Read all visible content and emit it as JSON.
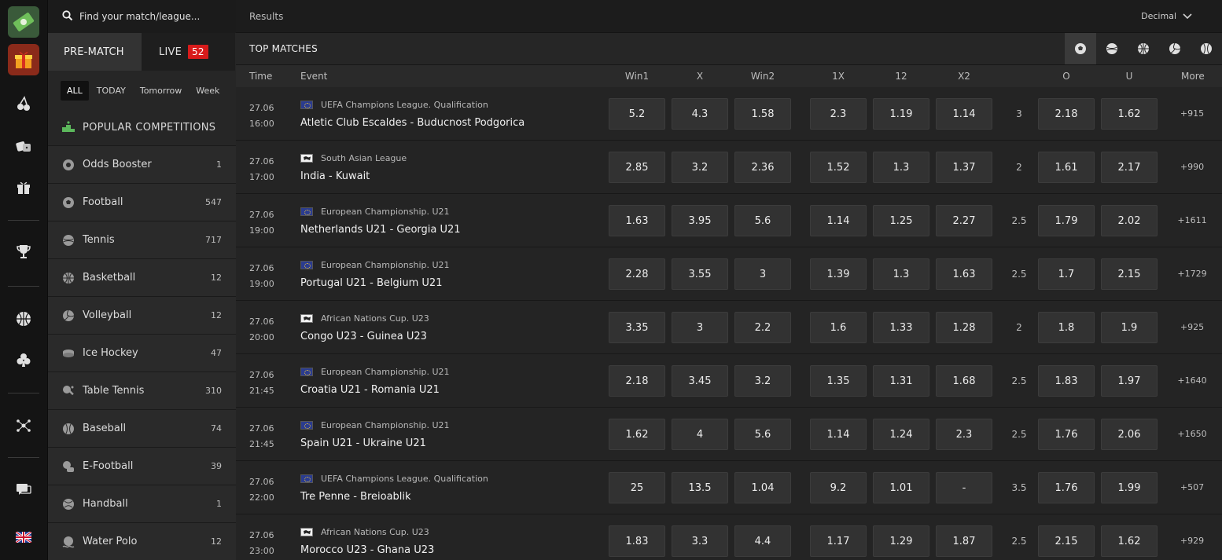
{
  "search": {
    "placeholder": "Find your match/league..."
  },
  "mode_tabs": {
    "prematch": "PRE-MATCH",
    "live": "LIVE",
    "live_count": "52"
  },
  "period_tabs": [
    "ALL",
    "TODAY",
    "Tomorrow",
    "Week"
  ],
  "popular_label": "POPULAR COMPETITIONS",
  "sports": [
    {
      "name": "Odds Booster",
      "count": "1",
      "icon": "odds-booster-icon"
    },
    {
      "name": "Football",
      "count": "547",
      "icon": "football-icon"
    },
    {
      "name": "Tennis",
      "count": "717",
      "icon": "tennis-icon"
    },
    {
      "name": "Basketball",
      "count": "12",
      "icon": "basketball-icon"
    },
    {
      "name": "Volleyball",
      "count": "12",
      "icon": "volleyball-icon"
    },
    {
      "name": "Ice Hockey",
      "count": "47",
      "icon": "ice-hockey-icon"
    },
    {
      "name": "Table Tennis",
      "count": "310",
      "icon": "table-tennis-icon"
    },
    {
      "name": "Baseball",
      "count": "74",
      "icon": "baseball-icon"
    },
    {
      "name": "E-Football",
      "count": "39",
      "icon": "e-football-icon"
    },
    {
      "name": "Handball",
      "count": "1",
      "icon": "handball-icon"
    },
    {
      "name": "Water Polo",
      "count": "12",
      "icon": "water-polo-icon"
    }
  ],
  "topbar": {
    "results": "Results",
    "odds_format": "Decimal"
  },
  "section_title": "TOP MATCHES",
  "columns": {
    "time": "Time",
    "event": "Event",
    "win1": "Win1",
    "x": "X",
    "win2": "Win2",
    "1x": "1X",
    "12": "12",
    "x2": "X2",
    "o": "O",
    "u": "U",
    "more": "More"
  },
  "matches": [
    {
      "date": "27.06",
      "time": "16:00",
      "flag": "eu",
      "league": "UEFA Champions League. Qualification",
      "event": "Atletic Club Escaldes - Buducnost Podgorica",
      "odds": [
        "5.2",
        "4.3",
        "1.58",
        "2.3",
        "1.19",
        "1.14"
      ],
      "total": "3",
      "over": "2.18",
      "under": "1.62",
      "more": "+915"
    },
    {
      "date": "27.06",
      "time": "17:00",
      "flag": "world",
      "league": "South Asian League",
      "event": "India - Kuwait",
      "odds": [
        "2.85",
        "3.2",
        "2.36",
        "1.52",
        "1.3",
        "1.37"
      ],
      "total": "2",
      "over": "1.61",
      "under": "2.17",
      "more": "+990"
    },
    {
      "date": "27.06",
      "time": "19:00",
      "flag": "eu",
      "league": "European Championship. U21",
      "event": "Netherlands U21 - Georgia U21",
      "odds": [
        "1.63",
        "3.95",
        "5.6",
        "1.14",
        "1.25",
        "2.27"
      ],
      "total": "2.5",
      "over": "1.79",
      "under": "2.02",
      "more": "+1611"
    },
    {
      "date": "27.06",
      "time": "19:00",
      "flag": "eu",
      "league": "European Championship. U21",
      "event": "Portugal U21 - Belgium U21",
      "odds": [
        "2.28",
        "3.55",
        "3",
        "1.39",
        "1.3",
        "1.63"
      ],
      "total": "2.5",
      "over": "1.7",
      "under": "2.15",
      "more": "+1729"
    },
    {
      "date": "27.06",
      "time": "20:00",
      "flag": "world",
      "league": "African Nations Cup. U23",
      "event": "Congo U23 - Guinea U23",
      "odds": [
        "3.35",
        "3",
        "2.2",
        "1.6",
        "1.33",
        "1.28"
      ],
      "total": "2",
      "over": "1.8",
      "under": "1.9",
      "more": "+925"
    },
    {
      "date": "27.06",
      "time": "21:45",
      "flag": "eu",
      "league": "European Championship. U21",
      "event": "Croatia U21 - Romania U21",
      "odds": [
        "2.18",
        "3.45",
        "3.2",
        "1.35",
        "1.31",
        "1.68"
      ],
      "total": "2.5",
      "over": "1.83",
      "under": "1.97",
      "more": "+1640"
    },
    {
      "date": "27.06",
      "time": "21:45",
      "flag": "eu",
      "league": "European Championship. U21",
      "event": "Spain U21 - Ukraine U21",
      "odds": [
        "1.62",
        "4",
        "5.6",
        "1.14",
        "1.24",
        "2.3"
      ],
      "total": "2.5",
      "over": "1.76",
      "under": "2.06",
      "more": "+1650"
    },
    {
      "date": "27.06",
      "time": "22:00",
      "flag": "eu",
      "league": "UEFA Champions League. Qualification",
      "event": "Tre Penne - Breioablik",
      "odds": [
        "25",
        "13.5",
        "1.04",
        "9.2",
        "1.01",
        "-"
      ],
      "total": "3.5",
      "over": "1.76",
      "under": "1.99",
      "more": "+507"
    },
    {
      "date": "27.06",
      "time": "23:00",
      "flag": "world",
      "league": "African Nations Cup. U23",
      "event": "Morocco U23 - Ghana U23",
      "odds": [
        "1.83",
        "3.3",
        "4.4",
        "1.17",
        "1.29",
        "1.87"
      ],
      "total": "2.5",
      "over": "2.15",
      "under": "1.62",
      "more": "+929"
    }
  ]
}
